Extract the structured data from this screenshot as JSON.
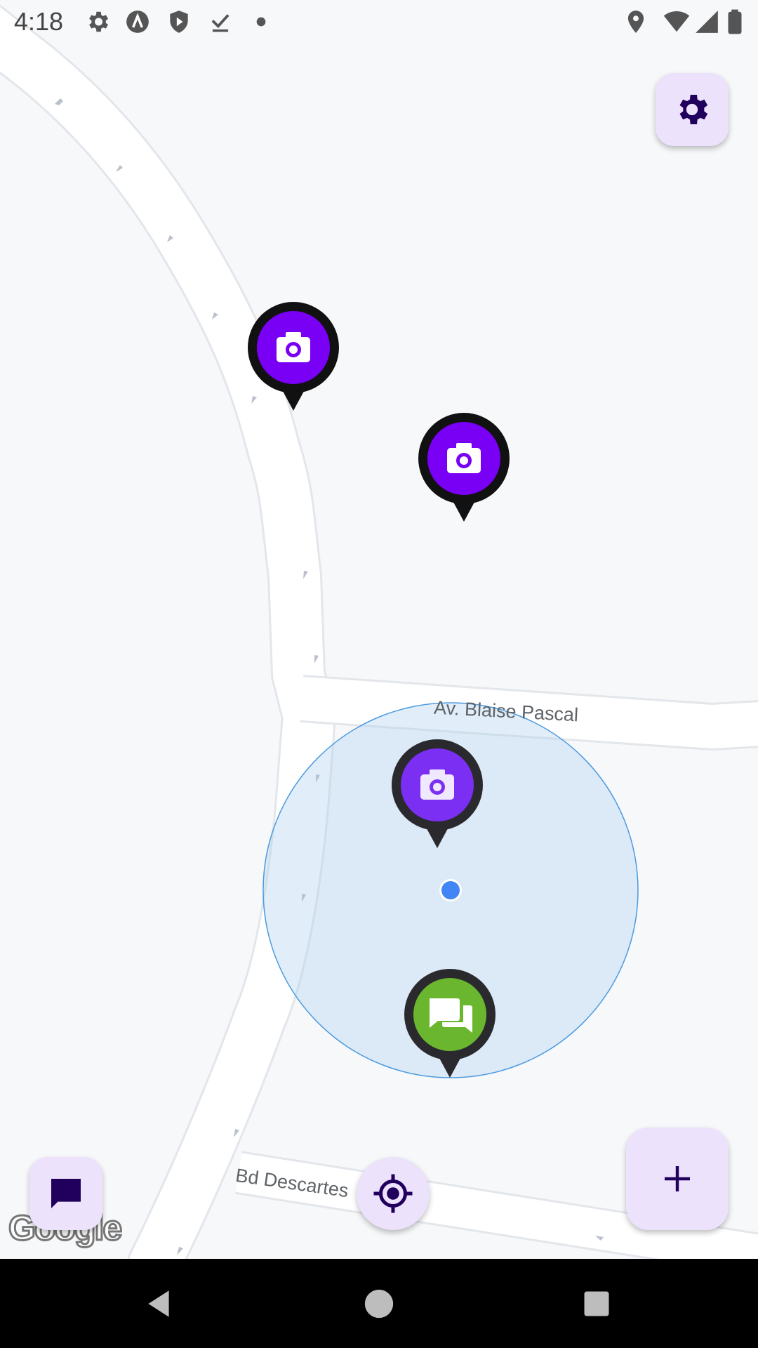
{
  "status_bar": {
    "time": "4:18",
    "left_icons": [
      "settings-icon",
      "a-circle-icon",
      "play-shield-icon",
      "download-done-icon",
      "dot-icon"
    ],
    "right_icons": [
      "location-icon",
      "wifi-icon",
      "cell-signal-icon",
      "battery-icon"
    ]
  },
  "map": {
    "street_labels": {
      "blaise_pascal": "Av. Blaise Pascal",
      "descartes": "Bd Descartes"
    },
    "markers": [
      {
        "type": "photo",
        "icon": "camera-icon",
        "color": "#7a00f5"
      },
      {
        "type": "photo",
        "icon": "camera-icon",
        "color": "#7a00f5"
      },
      {
        "type": "photo",
        "icon": "camera-icon",
        "color": "#7a00f5"
      },
      {
        "type": "chat",
        "icon": "forum-icon",
        "color": "#6ab72f"
      }
    ],
    "attribution": "Google",
    "accent_color": "#4285f4"
  },
  "buttons": {
    "settings": "settings-button",
    "chat": "chat-button",
    "my_location": "my-location-button",
    "add": "add-button"
  },
  "colors": {
    "fab_background": "#ece2fb",
    "fab_icon": "#21005d"
  },
  "nav_bar": {
    "items": [
      "back-icon",
      "home-icon",
      "recents-icon"
    ]
  }
}
